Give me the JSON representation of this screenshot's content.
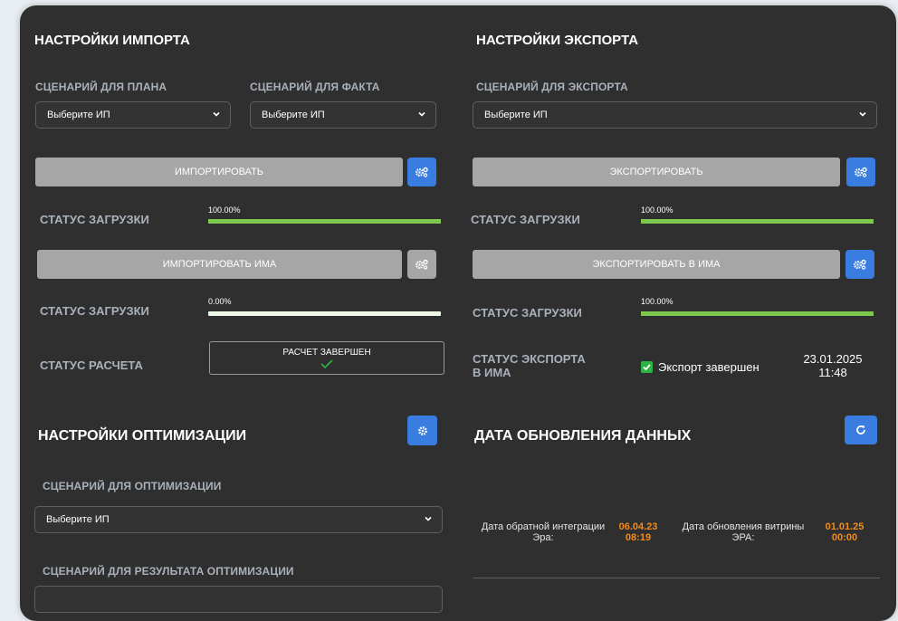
{
  "import": {
    "title": "НАСТРОЙКИ ИМПОРТА",
    "plan_label": "СЦЕНАРИЙ ДЛЯ ПЛАНА",
    "fact_label": "СЦЕНАРИЙ ДЛЯ ФАКТА",
    "plan_select": "Выберите ИП",
    "fact_select": "Выберите ИП",
    "import_button": "ИМПОРТИРОВАТЬ",
    "status_label": "СТАТУС ЗАГРУЗКИ",
    "status_value": "100.00%",
    "status_progress": 1.0,
    "import_ima_button": "ИМПОРТИРОВАТЬ ИМА",
    "status2_label": "СТАТУС ЗАГРУЗКИ",
    "status2_value": "0.00%",
    "status2_progress": 0.0,
    "calc_label": "СТАТУС РАСЧЕТА",
    "calc_value": "РАСЧЕТ ЗАВЕРШЕН"
  },
  "export": {
    "title": "НАСТРОЙКИ ЭКСПОРТА",
    "scenario_label": "СЦЕНАРИЙ ДЛЯ ЭКСПОРТА",
    "scenario_select": "Выберите ИП",
    "export_button": "ЭКСПОРТИРОВАТЬ",
    "status_label": "СТАТУС ЗАГРУЗКИ",
    "status_value": "100.00%",
    "status_progress": 1.0,
    "export_ima_button": "ЭКСПОРТИРОВАТЬ В ИМА",
    "status2_label": "СТАТУС ЗАГРУЗКИ",
    "status2_value": "100.00%",
    "status2_progress": 1.0,
    "ima_status_label_line1": "СТАТУС ЭКСПОРТА",
    "ima_status_label_line2": "В ИМА",
    "ima_status_text": "Экспорт завершен",
    "ima_status_date": "23.01.2025",
    "ima_status_time": "11:48"
  },
  "optimization": {
    "title": "НАСТРОЙКИ ОПТИМИЗАЦИИ",
    "scenario_label": "СЦЕНАРИЙ ДЛЯ ОПТИМИЗАЦИИ",
    "scenario_select": "Выберите ИП",
    "result_label": "СЦЕНАРИЙ ДЛЯ РЕЗУЛЬТАТА ОПТИМИЗАЦИИ"
  },
  "data_update": {
    "title": "ДАТА ОБНОВЛЕНИЯ ДАННЫХ",
    "reverse_label_line1": "Дата обратной интеграции",
    "reverse_label_line2": "Эра:",
    "reverse_date": "06.04.23",
    "reverse_time": "08:19",
    "showcase_label_line1": "Дата обновления витрины",
    "showcase_label_line2": "ЭРА:",
    "showcase_date": "01.01.25",
    "showcase_time": "00:00"
  },
  "colors": {
    "panel": "#2f2f2f",
    "accent_blue": "#3a7de0",
    "progress_green": "#7ec850",
    "progress_empty": "#eef8e6",
    "date_orange": "#f28c1c",
    "check_green": "#2fb344"
  }
}
